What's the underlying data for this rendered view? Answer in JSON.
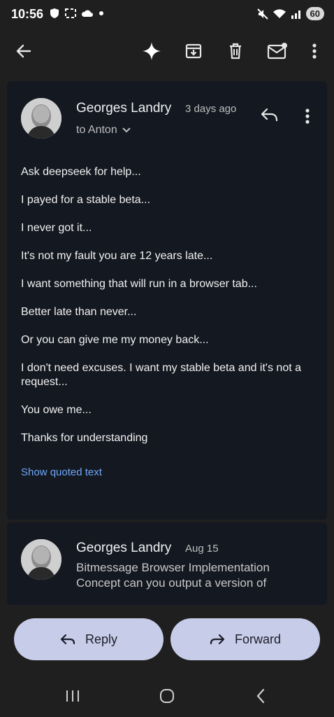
{
  "status": {
    "time": "10:56",
    "battery": "60"
  },
  "message1": {
    "sender": "Georges Landry",
    "date": "3 days ago",
    "recipient": "to Anton",
    "body": [
      "Ask deepseek for help...",
      "I payed for a stable beta...",
      "I never got it...",
      "It's not my fault you are 12 years late...",
      "I want something that will run in a browser tab...",
      "Better late than never...",
      "Or you can give me my money back...",
      "I don't need excuses. I want my stable beta and it's not a request...",
      "You owe me...",
      "Thanks for understanding"
    ],
    "show_quoted": "Show quoted text"
  },
  "message2": {
    "sender": "Georges Landry",
    "date": "Aug 15",
    "snippet": "Bitmessage Browser Implementation Concept can you output a version of"
  },
  "actions": {
    "reply": "Reply",
    "forward": "Forward"
  },
  "icons": {
    "back": "arrow-left-icon",
    "ai": "sparkle-icon",
    "archive": "archive-icon",
    "delete": "trash-icon",
    "mark_unread": "mail-unread-icon",
    "more": "more-vert-icon"
  }
}
